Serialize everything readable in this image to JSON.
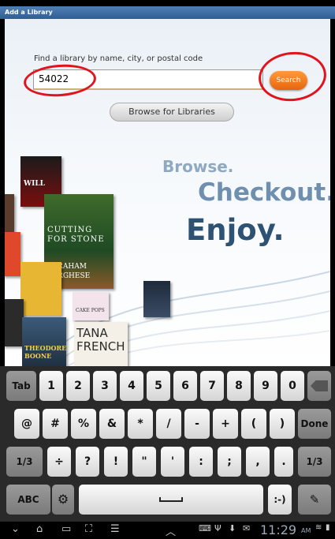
{
  "window": {
    "title": "Add a Library"
  },
  "search": {
    "prompt": "Find a library by name, city, or postal code",
    "value": "54022",
    "button_label": "Search"
  },
  "browse_button": {
    "label": "Browse for Libraries"
  },
  "tagline": {
    "line1": "Browse.",
    "line2": "Checkout.",
    "line3": "Enjoy."
  },
  "books": [
    {
      "title": "WILL"
    },
    {
      "title": "CUTTING FOR STONE"
    },
    {
      "author": "ABRAHAM VERGHESE"
    },
    {
      "title": "TANA FRENCH"
    },
    {
      "title": "CAKE POPS"
    },
    {
      "title": "THEODORE BOONE"
    }
  ],
  "keyboard": {
    "row1": [
      "Tab",
      "1",
      "2",
      "3",
      "4",
      "5",
      "6",
      "7",
      "8",
      "9",
      "0"
    ],
    "row2": [
      "@",
      "#",
      "%",
      "&",
      "*",
      "/",
      "-",
      "+",
      "(",
      ")",
      "Done"
    ],
    "row3": [
      "1/3",
      "÷",
      "?",
      "!",
      "\"",
      "'",
      ":",
      ";",
      ",",
      ".",
      "1/3"
    ],
    "row4": {
      "abc": "ABC",
      "smiley": ":-)"
    }
  },
  "statusbar": {
    "time": "11:29",
    "ampm": "AM"
  },
  "colors": {
    "accent_orange": "#e6650e",
    "title_blue": "#2f5e95",
    "annotation_red": "#e0141e"
  }
}
